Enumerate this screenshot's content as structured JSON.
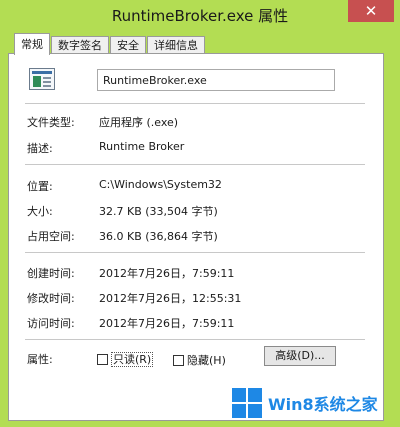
{
  "window": {
    "title": "RuntimeBroker.exe 属性",
    "close_glyph": "✕"
  },
  "tabs": [
    {
      "label": "常规",
      "active": true
    },
    {
      "label": "数字签名",
      "active": false
    },
    {
      "label": "安全",
      "active": false
    },
    {
      "label": "详细信息",
      "active": false
    }
  ],
  "file": {
    "name": "RuntimeBroker.exe"
  },
  "props": {
    "type_label": "文件类型:",
    "type_value": "应用程序 (.exe)",
    "desc_label": "描述:",
    "desc_value": "Runtime Broker",
    "loc_label": "位置:",
    "loc_value": "C:\\Windows\\System32",
    "size_label": "大小:",
    "size_value": "32.7 KB (33,504 字节)",
    "disk_label": "占用空间:",
    "disk_value": "36.0 KB (36,864 字节)",
    "created_label": "创建时间:",
    "created_value": "2012年7月26日，7:59:11",
    "modified_label": "修改时间:",
    "modified_value": "2012年7月26日，12:55:31",
    "accessed_label": "访问时间:",
    "accessed_value": "2012年7月26日，7:59:11"
  },
  "attributes": {
    "label": "属性:",
    "readonly_label": "只读(R)",
    "readonly_checked": false,
    "hidden_label": "隐藏(H)",
    "hidden_checked": false,
    "advanced_label": "高级(D)..."
  },
  "watermark": {
    "text": "Win8系统之家"
  },
  "colors": {
    "background": "#b3dd53",
    "close_button": "#c75050",
    "logo_blue": "#1e88e5"
  }
}
